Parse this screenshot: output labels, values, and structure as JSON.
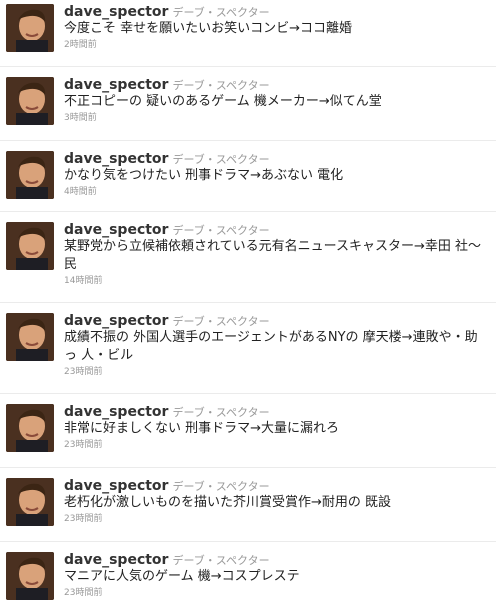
{
  "tweets": [
    {
      "username": "dave_spector",
      "fullname": "デーブ・スペクター",
      "text": "今度こそ 幸せを願いたいお笑いコンビ→ココ離婚",
      "time": "2時間前"
    },
    {
      "username": "dave_spector",
      "fullname": "デーブ・スペクター",
      "text": "不正コピーの 疑いのあるゲーム 機メーカー→似てん堂",
      "time": "3時間前"
    },
    {
      "username": "dave_spector",
      "fullname": "デーブ・スペクター",
      "text": "かなり気をつけたい 刑事ドラマ→あぶない 電化",
      "time": "4時間前"
    },
    {
      "username": "dave_spector",
      "fullname": "デーブ・スペクター",
      "text": "某野党から立候補依頼されている元有名ニュースキャスター→幸田 社～民",
      "time": "14時間前"
    },
    {
      "username": "dave_spector",
      "fullname": "デーブ・スペクター",
      "text": "成績不振の 外国人選手のエージェントがあるNYの 摩天楼→連敗や・助っ 人・ビル",
      "time": "23時間前"
    },
    {
      "username": "dave_spector",
      "fullname": "デーブ・スペクター",
      "text": "非常に好ましくない 刑事ドラマ→大量に漏れろ",
      "time": "23時間前"
    },
    {
      "username": "dave_spector",
      "fullname": "デーブ・スペクター",
      "text": "老朽化が激しいものを描いた芥川賞受賞作→耐用の 既設",
      "time": "23時間前"
    },
    {
      "username": "dave_spector",
      "fullname": "デーブ・スペクター",
      "text": "マニアに人気のゲーム 機→コスプレステ",
      "time": "23時間前"
    }
  ]
}
